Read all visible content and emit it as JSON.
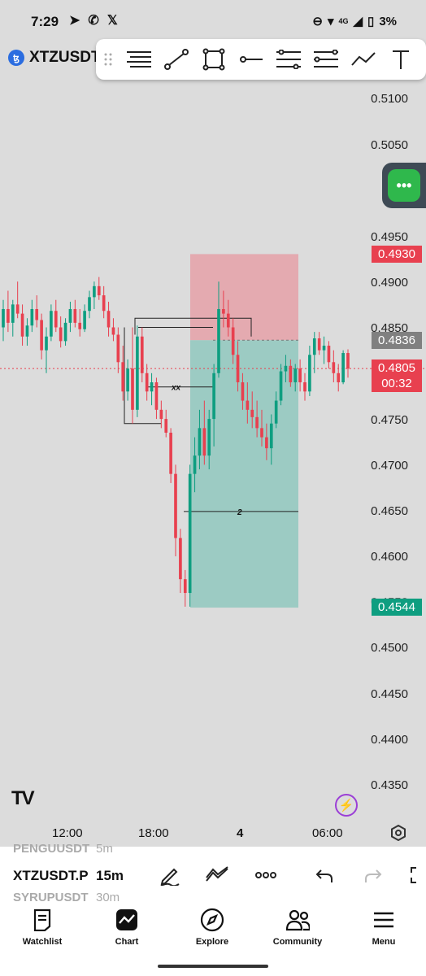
{
  "status_bar": {
    "time": "7:29",
    "battery": "3%",
    "network": "4G"
  },
  "symbol": {
    "name": "XTZUSDT",
    "coin_glyph": "ꜩ"
  },
  "drawing_toolbar": {
    "tools": [
      "horizontal-lines-icon",
      "trend-line-icon",
      "rectangle-icon",
      "ray-icon",
      "fib-levels-icon",
      "pitchfork-icon",
      "path-icon",
      "text-icon"
    ]
  },
  "price_axis": [
    "0.5100",
    "0.5050",
    "0.4950",
    "0.4900",
    "0.4850",
    "0.4750",
    "0.4700",
    "0.4650",
    "0.4600",
    "0.4550",
    "0.4500",
    "0.4450",
    "0.4400",
    "0.4350"
  ],
  "price_tags": {
    "stop": "0.4930",
    "entry": "0.4836",
    "last": "0.4805",
    "countdown": "00:32",
    "target": "0.4544"
  },
  "annotations": {
    "xx_label": "xx",
    "target_label": "2"
  },
  "time_axis": {
    "labels": [
      "12:00",
      "18:00",
      "4",
      "06:00"
    ]
  },
  "bottom_bar": {
    "symbol": "XTZUSDT.P",
    "symbol_above": "PENGUUSDT",
    "symbol_below": "SYRUPUSDT",
    "interval": "15m",
    "interval_above": "5m",
    "interval_below": "30m"
  },
  "nav": {
    "items": [
      {
        "label": "Watchlist"
      },
      {
        "label": "Chart"
      },
      {
        "label": "Explore"
      },
      {
        "label": "Community"
      },
      {
        "label": "Menu"
      }
    ]
  },
  "colors": {
    "up": "#0e9e80",
    "down": "#e8404f",
    "stop_zone": "#e4aab0",
    "target_zone": "#9ccbc3"
  },
  "chart_data": {
    "type": "candlestick",
    "title": "XTZUSDT",
    "ylim": [
      0.432,
      0.513
    ],
    "candles": [
      [
        0.485,
        0.488,
        0.4835,
        0.487
      ],
      [
        0.487,
        0.489,
        0.4845,
        0.4855
      ],
      [
        0.4855,
        0.488,
        0.484,
        0.4875
      ],
      [
        0.4875,
        0.49,
        0.486,
        0.4865
      ],
      [
        0.4865,
        0.4875,
        0.483,
        0.484
      ],
      [
        0.484,
        0.486,
        0.483,
        0.4852
      ],
      [
        0.4852,
        0.488,
        0.4845,
        0.487
      ],
      [
        0.487,
        0.4885,
        0.485,
        0.4858
      ],
      [
        0.4858,
        0.4865,
        0.4815,
        0.4825
      ],
      [
        0.4825,
        0.485,
        0.48,
        0.484
      ],
      [
        0.484,
        0.4875,
        0.4835,
        0.4868
      ],
      [
        0.4868,
        0.488,
        0.4845,
        0.485
      ],
      [
        0.485,
        0.4862,
        0.4828,
        0.4835
      ],
      [
        0.4835,
        0.486,
        0.483,
        0.4855
      ],
      [
        0.4855,
        0.4878,
        0.4845,
        0.487
      ],
      [
        0.487,
        0.488,
        0.485,
        0.4855
      ],
      [
        0.4855,
        0.487,
        0.484,
        0.4848
      ],
      [
        0.4848,
        0.4875,
        0.4845,
        0.4868
      ],
      [
        0.4868,
        0.489,
        0.486,
        0.4883
      ],
      [
        0.4883,
        0.49,
        0.487,
        0.4895
      ],
      [
        0.4895,
        0.4905,
        0.488,
        0.4885
      ],
      [
        0.4885,
        0.4895,
        0.486,
        0.4868
      ],
      [
        0.4868,
        0.4878,
        0.484,
        0.485
      ],
      [
        0.485,
        0.486,
        0.4835,
        0.4842
      ],
      [
        0.4842,
        0.485,
        0.48,
        0.4812
      ],
      [
        0.4812,
        0.483,
        0.477,
        0.478
      ],
      [
        0.478,
        0.4815,
        0.477,
        0.4805
      ],
      [
        0.4805,
        0.485,
        0.4745,
        0.476
      ],
      [
        0.476,
        0.4852,
        0.4752,
        0.484
      ],
      [
        0.484,
        0.485,
        0.479,
        0.48
      ],
      [
        0.48,
        0.481,
        0.477,
        0.478
      ],
      [
        0.478,
        0.48,
        0.4765,
        0.479
      ],
      [
        0.479,
        0.4795,
        0.475,
        0.476
      ],
      [
        0.476,
        0.477,
        0.474,
        0.475
      ],
      [
        0.475,
        0.476,
        0.473,
        0.4735
      ],
      [
        0.4735,
        0.474,
        0.468,
        0.469
      ],
      [
        0.469,
        0.47,
        0.46,
        0.462
      ],
      [
        0.462,
        0.463,
        0.456,
        0.4575
      ],
      [
        0.4575,
        0.4585,
        0.4545,
        0.456
      ],
      [
        0.456,
        0.47,
        0.4545,
        0.469
      ],
      [
        0.469,
        0.473,
        0.467,
        0.471
      ],
      [
        0.471,
        0.476,
        0.4695,
        0.474
      ],
      [
        0.474,
        0.477,
        0.47,
        0.471
      ],
      [
        0.471,
        0.476,
        0.4695,
        0.475
      ],
      [
        0.475,
        0.481,
        0.472,
        0.48
      ],
      [
        0.48,
        0.49,
        0.4795,
        0.487
      ],
      [
        0.487,
        0.489,
        0.485,
        0.4865
      ],
      [
        0.4865,
        0.488,
        0.484,
        0.485
      ],
      [
        0.485,
        0.486,
        0.481,
        0.482
      ],
      [
        0.482,
        0.4835,
        0.478,
        0.479
      ],
      [
        0.479,
        0.48,
        0.476,
        0.477
      ],
      [
        0.477,
        0.479,
        0.4745,
        0.476
      ],
      [
        0.476,
        0.478,
        0.474,
        0.4752
      ],
      [
        0.4752,
        0.477,
        0.473,
        0.474
      ],
      [
        0.474,
        0.476,
        0.472,
        0.473
      ],
      [
        0.473,
        0.4745,
        0.4705,
        0.4718
      ],
      [
        0.4718,
        0.4755,
        0.47,
        0.4745
      ],
      [
        0.4745,
        0.478,
        0.474,
        0.477
      ],
      [
        0.477,
        0.481,
        0.4765,
        0.4802
      ],
      [
        0.4802,
        0.482,
        0.479,
        0.4808
      ],
      [
        0.4808,
        0.4815,
        0.4785,
        0.479
      ],
      [
        0.479,
        0.481,
        0.478,
        0.4805
      ],
      [
        0.4805,
        0.4815,
        0.478,
        0.479
      ],
      [
        0.479,
        0.48,
        0.477,
        0.478
      ],
      [
        0.478,
        0.483,
        0.4775,
        0.482
      ],
      [
        0.482,
        0.4845,
        0.48,
        0.4838
      ],
      [
        0.4838,
        0.4845,
        0.482,
        0.4825
      ],
      [
        0.4825,
        0.484,
        0.481,
        0.483
      ],
      [
        0.483,
        0.4835,
        0.4805,
        0.4812
      ],
      [
        0.4812,
        0.4825,
        0.479,
        0.48
      ],
      [
        0.48,
        0.481,
        0.478,
        0.479
      ],
      [
        0.479,
        0.4825,
        0.4788,
        0.4822
      ],
      [
        0.4822,
        0.4826,
        0.4795,
        0.4805
      ]
    ],
    "candle_columns": [
      "open",
      "high",
      "low",
      "close"
    ],
    "position": {
      "entry": 0.4836,
      "stop": 0.493,
      "target": 0.4544
    }
  }
}
